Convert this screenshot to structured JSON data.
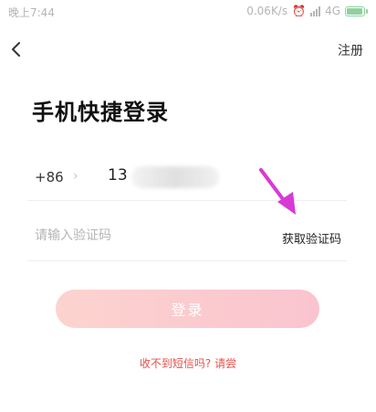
{
  "status_bar": {
    "time": "晚上7:44",
    "network_speed": "0.06K/s",
    "network_type": "4G",
    "battery_level": 0.85,
    "icons": [
      "alarm-icon",
      "signal-icon",
      "battery-icon"
    ]
  },
  "header": {
    "back_icon": "chevron-left-icon",
    "register_label": "注册"
  },
  "title": "手机快捷登录",
  "phone": {
    "country_code": "+86",
    "value": "13",
    "masked": true
  },
  "code": {
    "placeholder": "请输入验证码",
    "get_code_label": "获取验证码"
  },
  "login_label": "登录",
  "sms_help": "收不到短信吗? 请尝",
  "colors": {
    "accent": "#e8504a",
    "button_start": "#fcd3cf",
    "button_end": "#fac4cf",
    "annotation_arrow": "#d83ad6",
    "battery": "#8fd19e"
  }
}
